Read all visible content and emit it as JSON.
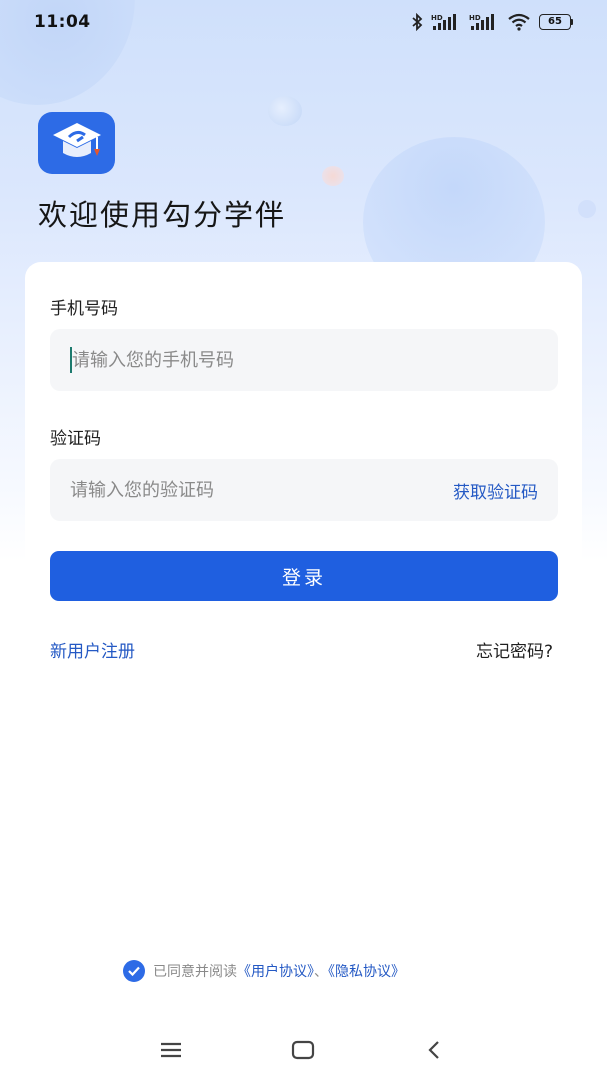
{
  "status_bar": {
    "time": "11:04",
    "battery": "65",
    "icons": [
      "bluetooth-icon",
      "hd-signal-icon",
      "hd-signal-icon",
      "wifi-icon",
      "battery-icon"
    ]
  },
  "header": {
    "logo_icon": "graduation-cap-logo-icon",
    "welcome": "欢迎使用勾分学伴"
  },
  "form": {
    "phone_label": "手机号码",
    "phone_placeholder": "请输入您的手机号码",
    "phone_value": "",
    "code_label": "验证码",
    "code_placeholder": "请输入您的验证码",
    "code_value": "",
    "get_code": "获取验证码",
    "login": "登录",
    "register": "新用户注册",
    "forgot": "忘记密码?"
  },
  "agreement": {
    "checked": true,
    "prefix": "已同意并阅读",
    "user_agreement": "《用户协议》",
    "separator": "、",
    "privacy_policy": "《隐私协议》"
  },
  "nav_bar": {
    "icons": [
      "menu-icon",
      "home-icon",
      "back-icon"
    ]
  },
  "colors": {
    "accent": "#1f5fe0",
    "link": "#2459c4",
    "input_bg": "#f5f6f8"
  }
}
